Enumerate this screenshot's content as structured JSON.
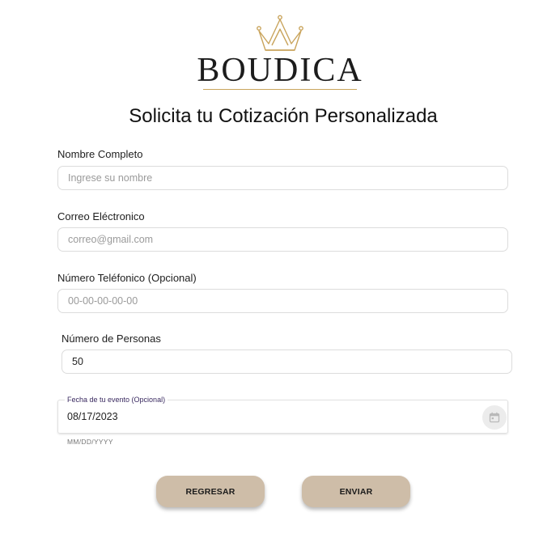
{
  "brand": {
    "name": "BOUDICA",
    "accent_color": "#c9a45c"
  },
  "page": {
    "title": "Solicita tu Cotización Personalizada"
  },
  "form": {
    "name": {
      "label": "Nombre Completo",
      "placeholder": "Ingrese su nombre",
      "value": ""
    },
    "email": {
      "label": "Correo Eléctronico",
      "placeholder": "correo@gmail.com",
      "value": ""
    },
    "phone": {
      "label": "Número Teléfonico (Opcional)",
      "placeholder": "00-00-00-00-00",
      "value": ""
    },
    "people": {
      "label": "Número de Personas",
      "value": "50"
    },
    "date": {
      "label": "Fecha de tu evento (Opcional)",
      "value": "08/17/2023",
      "hint": "MM/DD/YYYY",
      "icon": "calendar-icon"
    }
  },
  "buttons": {
    "back": "REGRESAR",
    "submit": "ENVIAR",
    "color": "#cebda8"
  }
}
